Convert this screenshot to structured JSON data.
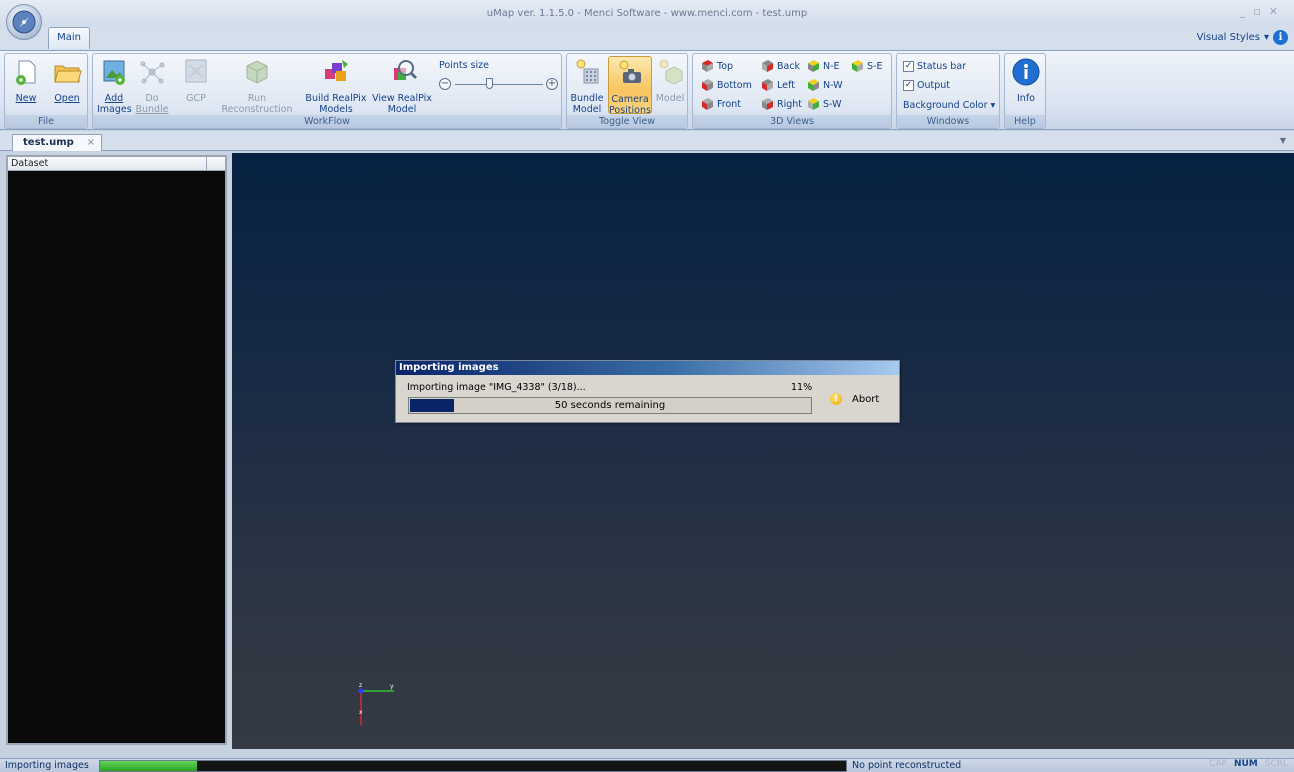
{
  "window": {
    "title": "uMap ver. 1.1.5.0 - Menci Software - www.menci.com  - test.ump"
  },
  "ribbon_tabs": {
    "main": "Main"
  },
  "visual_styles": {
    "label": "Visual Styles",
    "arrow": "▾"
  },
  "ribbon": {
    "file": {
      "label": "File",
      "new": "New",
      "open": "Open"
    },
    "workflow": {
      "label": "WorkFlow",
      "add_images_line1": "Add",
      "add_images_line2": "Images",
      "do_bundle_line1": "Do",
      "do_bundle_line2": "Bundle",
      "gcp": "GCP",
      "run_reconstruction_line1": "Run",
      "run_reconstruction_line2": "Reconstruction",
      "build_realpix_line1": "Build RealPix",
      "build_realpix_line2": "Models",
      "view_realpix_line1": "View RealPix",
      "view_realpix_line2": "Model",
      "points_size_label": "Points size",
      "points_size_minus": "−",
      "points_size_plus": "+",
      "points_size_level": 0.4
    },
    "toggle_view": {
      "label": "Toggle View",
      "bundle_line1": "Bundle",
      "bundle_line2": "Model",
      "camera_line1": "Camera",
      "camera_line2": "Positions",
      "model": "Model"
    },
    "views_3d": {
      "label": "3D Views",
      "top": "Top",
      "bottom": "Bottom",
      "front": "Front",
      "back": "Back",
      "left": "Left",
      "right": "Right",
      "ne": "N-E",
      "nw": "N-W",
      "sw": "S-W",
      "se": "S-E"
    },
    "windows": {
      "label": "Windows",
      "status_bar": "Status bar",
      "output": "Output",
      "background_color": "Background Color",
      "dropdown_arrow": "▾",
      "check": "✓"
    },
    "help": {
      "label": "Help",
      "info": "Info",
      "info_glyph": "i"
    }
  },
  "document_tab": {
    "name": "test.ump",
    "close": "×",
    "dropdown": "▼"
  },
  "dataset_panel": {
    "header": "Dataset"
  },
  "gizmo": {
    "x": "x",
    "y": "y",
    "z": "z"
  },
  "progress_dialog": {
    "title": "Importing images",
    "message": "Importing image \"IMG_4338\" (3/18)...",
    "percent_text": "11%",
    "progress": 0.11,
    "remaining": "50 seconds remaining",
    "abort": "Abort",
    "warn_glyph": "!"
  },
  "statusbar": {
    "left_text": "Importing images",
    "progress": 0.13,
    "point_text": "No point reconstructed",
    "keys": [
      "CAP",
      "NUM",
      "SCRL"
    ]
  },
  "colors": {
    "ribbon_accent": "#15428b",
    "active_toggle": "#f7c45e",
    "dialog_title_start": "#0a246a",
    "viewport_top": "#062142",
    "statusbar_fill": "#2aa322"
  },
  "icons": {
    "app_orb": "compass-orb-icon",
    "new": "new-document-icon",
    "open": "open-folder-icon",
    "add_images": "add-image-icon",
    "do_bundle": "bundle-network-icon",
    "gcp": "gcp-icon",
    "run_reconstruction": "reconstruction-icon",
    "build_realpix": "build-models-icon",
    "view_realpix": "view-model-icon",
    "bundle_model": "bundle-model-icon",
    "camera_positions": "camera-icon",
    "model": "model-cube-icon",
    "info": "info-icon"
  }
}
